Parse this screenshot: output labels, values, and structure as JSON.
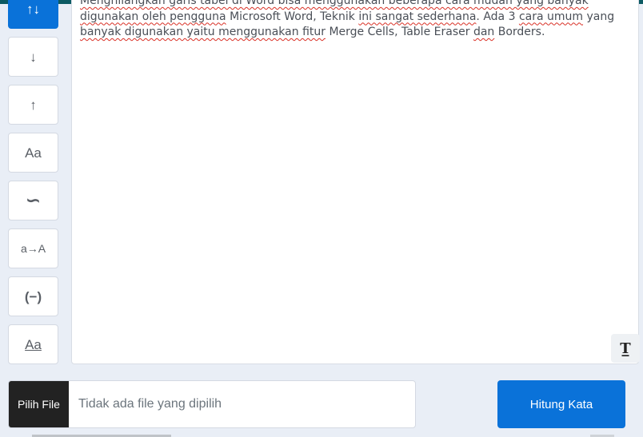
{
  "theme": {
    "accent": "#0a72d9",
    "top_bar": "#0c5a63",
    "file_button": "#222222"
  },
  "sidebar": {
    "buttons": [
      {
        "icon": "sort-icon",
        "glyph": "↑↓",
        "active": true
      },
      {
        "icon": "arrow-down-icon",
        "glyph": "↓",
        "active": false
      },
      {
        "icon": "arrow-up-icon",
        "glyph": "↑",
        "active": false
      },
      {
        "icon": "text-case-icon",
        "glyph": "Aa",
        "active": false
      },
      {
        "icon": "wave-icon",
        "glyph": "∽",
        "active": false
      },
      {
        "icon": "lower-to-upper-icon",
        "glyph": "a→A",
        "active": false
      },
      {
        "icon": "parentheses-minus-icon",
        "glyph": "(−)",
        "active": false
      },
      {
        "icon": "underline-text-icon",
        "glyph": "Aa",
        "active": false
      }
    ]
  },
  "editor": {
    "line1": "Menghilangkan garis tabel di Word bisa menggunakan beberapa cara mudah yang banyak",
    "line2_a": "digunakan oleh pengguna",
    "line2_b": " Microsoft Word, Teknik ",
    "line2_c": "ini sangat sederhana",
    "line2_d": ". Ada 3 ",
    "line2_e": "cara umum",
    "line2_f": " yang",
    "line3_a": "banyak digunakan yaitu menggunakan fitur",
    "line3_b": " Merge Cells, Table Eraser ",
    "line3_c": "dan",
    "line3_d": " Borders.",
    "font_toggle_icon": "font-toggle-icon",
    "font_toggle_glyph": "T̲"
  },
  "file_input": {
    "button_label": "Pilih File",
    "status_text": "Tidak ada file yang dipilih"
  },
  "count_button": {
    "label": "Hitung Kata"
  }
}
